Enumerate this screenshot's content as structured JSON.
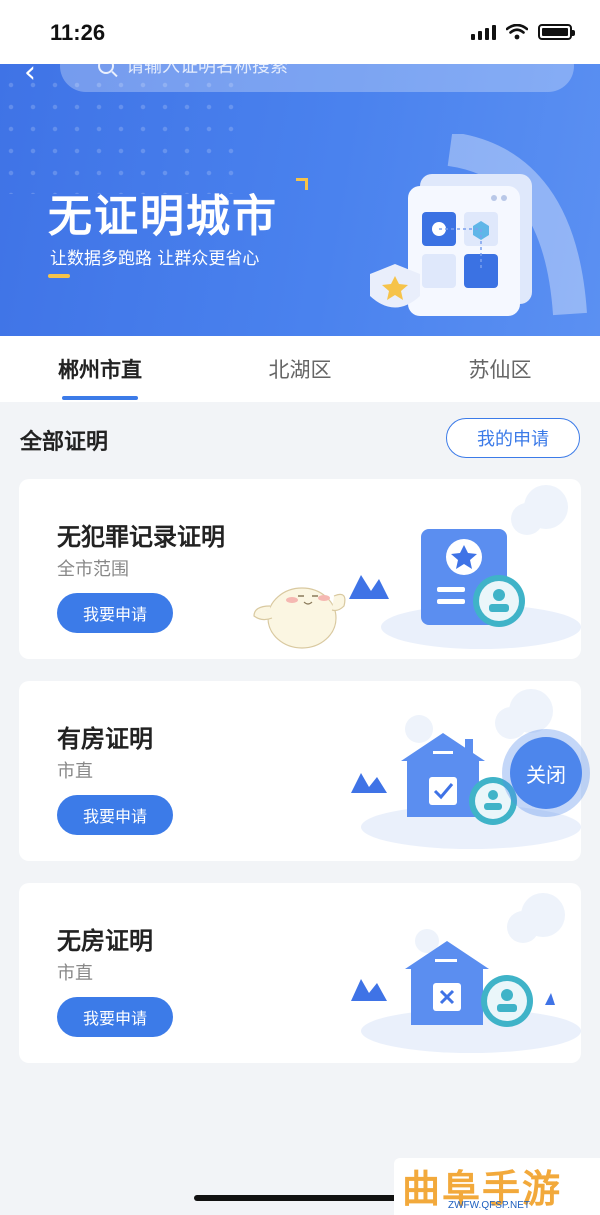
{
  "status_bar": {
    "time": "11:26"
  },
  "header": {
    "search_placeholder": "请输入证明名称搜索",
    "banner_title": "无证明城市",
    "banner_subtitle": "让数据多跑路 让群众更省心"
  },
  "tabs": [
    {
      "label": "郴州市直",
      "active": true
    },
    {
      "label": "北湖区",
      "active": false
    },
    {
      "label": "苏仙区",
      "active": false
    }
  ],
  "section": {
    "title": "全部证明",
    "my_apply_label": "我的申请"
  },
  "cards": [
    {
      "title": "无犯罪记录证明",
      "scope": "全市范围",
      "button_label": "我要申请",
      "icon": "certificate-icon"
    },
    {
      "title": "有房证明",
      "scope": "市直",
      "button_label": "我要申请",
      "icon": "house-check-icon"
    },
    {
      "title": "无房证明",
      "scope": "市直",
      "button_label": "我要申请",
      "icon": "house-cross-icon"
    }
  ],
  "floating": {
    "close_label": "关闭"
  },
  "watermark": {
    "text": "曲阜手游网",
    "url": "ZWFW.QFSP.NET"
  },
  "colors": {
    "primary": "#3c7be8",
    "banner": "#4a82ee",
    "accent": "#f6c34a",
    "background": "#f2f4f7"
  }
}
